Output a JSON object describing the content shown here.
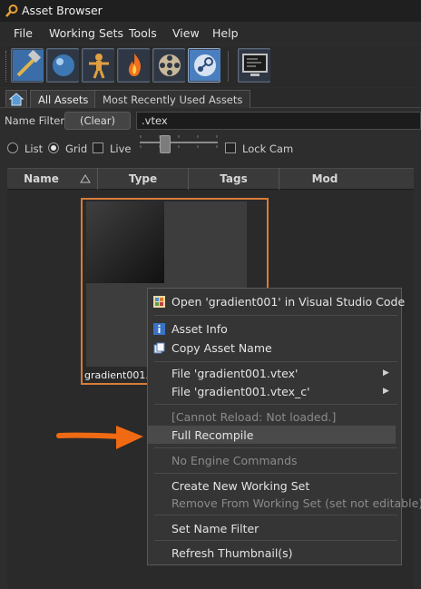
{
  "window": {
    "title": "Asset Browser"
  },
  "menubar": {
    "items": [
      "File",
      "Working Sets",
      "Tools",
      "View",
      "Help"
    ]
  },
  "toolbar": {
    "tools": [
      "hammer-tool-icon",
      "material-sphere-icon",
      "model-figure-icon",
      "particle-flame-icon",
      "film-reel-icon",
      "steam-icon",
      "console-monitor-icon"
    ]
  },
  "tabs": {
    "items": [
      "All Assets",
      "Most Recently Used Assets"
    ],
    "active": "All Assets"
  },
  "filter": {
    "label": "Name Filter:",
    "clear_label": "(Clear)",
    "value": ".vtex"
  },
  "view_options": {
    "list_label": "List",
    "grid_label": "Grid",
    "live_label": "Live",
    "lock_cam_label": "Lock Cam",
    "selected_view": "Grid",
    "thumbnail_size_fraction": 0.32
  },
  "columns": [
    "Name",
    "Type",
    "Tags",
    "Mod"
  ],
  "asset": {
    "label": "gradient001.vt"
  },
  "context_menu": {
    "open_vscode": "Open 'gradient001' in Visual Studio Code",
    "asset_info": "Asset Info",
    "copy_name": "Copy Asset Name",
    "file_vtex": "File 'gradient001.vtex'",
    "file_vtex_c": "File 'gradient001.vtex_c'",
    "cannot_reload": "[Cannot Reload: Not loaded.]",
    "full_recompile": "Full Recompile",
    "no_engine": "No Engine Commands",
    "create_ws": "Create New Working Set",
    "remove_ws": "Remove From Working Set (set not editable)",
    "set_filter": "Set Name Filter",
    "refresh": "Refresh Thumbnail(s)",
    "highlighted": "Full Recompile"
  },
  "colors": {
    "selection_border": "#d77d3a",
    "annotation_arrow": "#f06a14",
    "accent_blue": "#4a7fbf"
  }
}
